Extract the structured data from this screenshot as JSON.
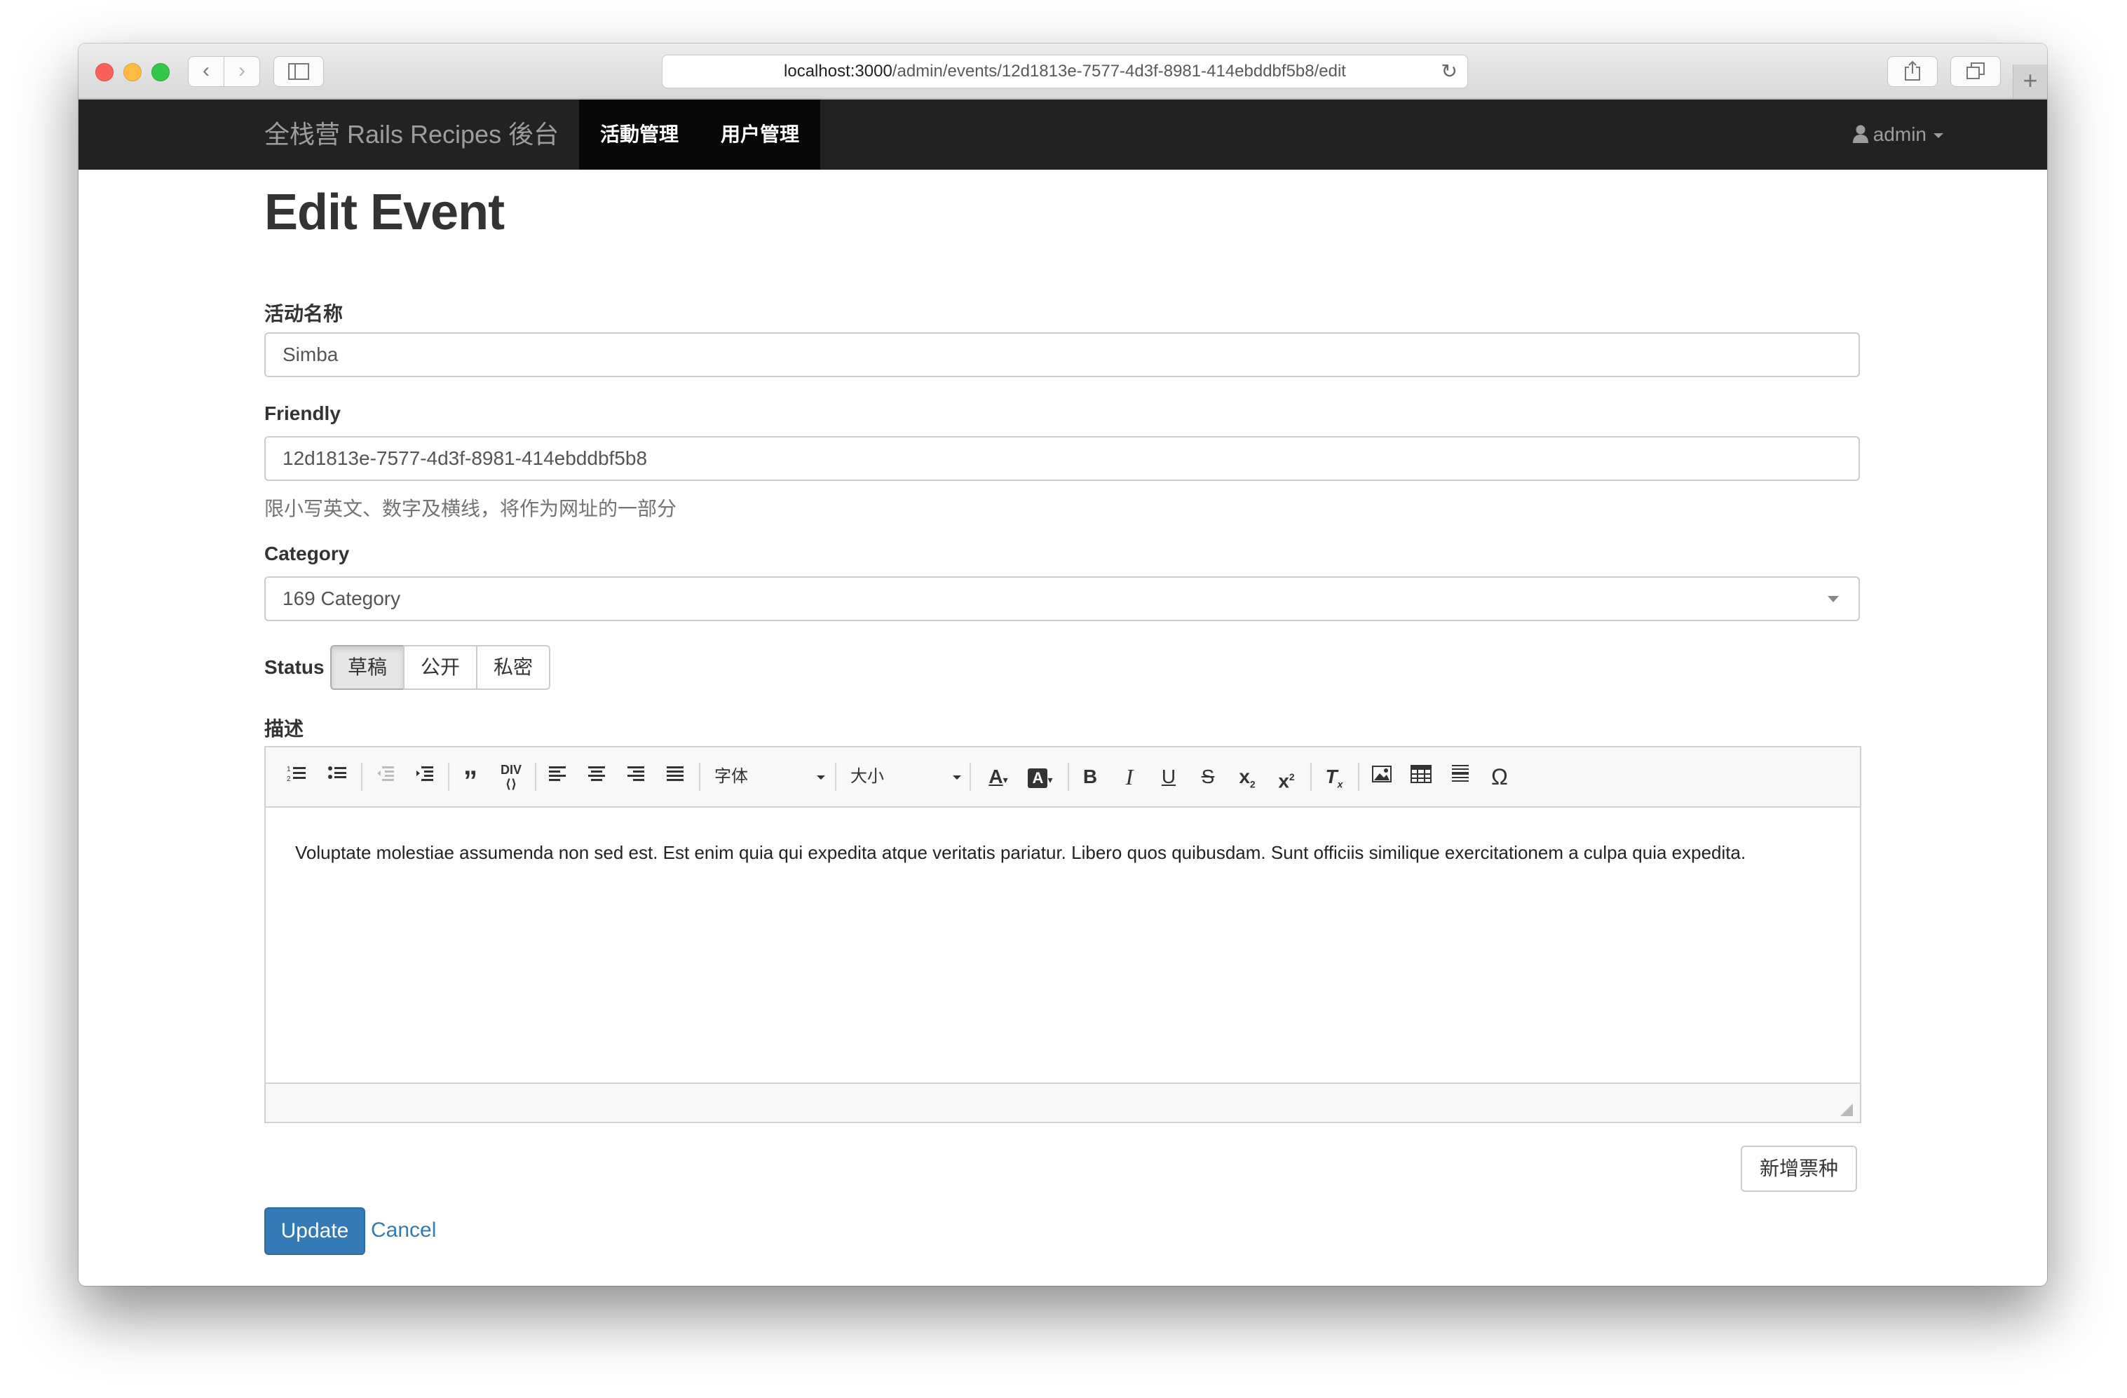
{
  "browser": {
    "url_host": "localhost:3000",
    "url_path": "/admin/events/12d1813e-7577-4d3f-8981-414ebddbf5b8/edit"
  },
  "navbar": {
    "brand": "全栈营 Rails Recipes 後台",
    "items": [
      {
        "label": "活動管理"
      },
      {
        "label": "用户管理"
      }
    ],
    "user": "admin"
  },
  "page": {
    "title": "Edit Event"
  },
  "form": {
    "name_label": "活动名称",
    "name_value": "Simba",
    "friendly_label": "Friendly",
    "friendly_value": "12d1813e-7577-4d3f-8981-414ebddbf5b8",
    "friendly_help": "限小写英文、数字及横线，将作为网址的一部分",
    "category_label": "Category",
    "category_value": "169 Category",
    "status_label": "Status",
    "status_options": [
      "草稿",
      "公开",
      "私密"
    ],
    "status_selected": "草稿",
    "description_label": "描述",
    "description_text": "Voluptate molestiae assumenda non sed est. Est enim quia qui expedita atque veritatis pariatur. Libero quos quibusdam. Sunt officiis similique exercitationem a culpa quia expedita.",
    "font_combo": "字体",
    "size_combo": "大小",
    "add_ticket_button": "新增票种",
    "update_button": "Update",
    "cancel_link": "Cancel"
  },
  "toolbar_icons": [
    "numbered-list-icon",
    "bulleted-list-icon",
    "outdent-icon",
    "indent-icon",
    "blockquote-icon",
    "create-div-icon",
    "align-left-icon",
    "align-center-icon",
    "align-right-icon",
    "justify-icon",
    "text-color-icon",
    "background-color-icon",
    "bold-icon",
    "italic-icon",
    "underline-icon",
    "strikethrough-icon",
    "subscript-icon",
    "superscript-icon",
    "remove-format-icon",
    "image-icon",
    "table-icon",
    "horizontal-line-icon",
    "special-char-icon"
  ],
  "colors": {
    "navbar_bg": "#222222",
    "navbar_active": "#080808",
    "primary": "#337ab7",
    "link": "#337ab7"
  }
}
